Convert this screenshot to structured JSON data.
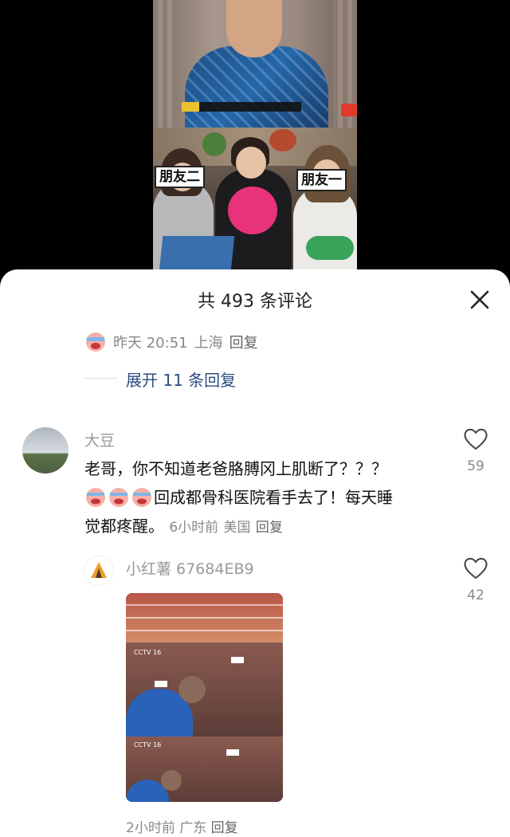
{
  "video": {
    "label_left": "朋友二",
    "label_right": "朋友一"
  },
  "sheet": {
    "title": "共 493 条评论",
    "close_icon": "close-icon"
  },
  "prev_comment": {
    "meta_time": "昨天 20:51",
    "meta_location": "上海",
    "meta_reply": "回复",
    "expand_label": "展开 11 条回复"
  },
  "comment": {
    "username": "大豆",
    "text_line1": "老哥，你不知道老爸胳膊冈上肌断了？？？",
    "text_line2": "回成都骨科医院看手去了！每天睡",
    "text_line3": "觉都疼醒。",
    "time": "6小时前",
    "location": "美国",
    "reply_label": "回复",
    "like_count": "59"
  },
  "reply": {
    "username": "小红薯 67684EB9",
    "like_count": "42",
    "time": "2小时前",
    "location": "广东",
    "reply_label": "回复",
    "image_logo": "CCTV 16"
  }
}
